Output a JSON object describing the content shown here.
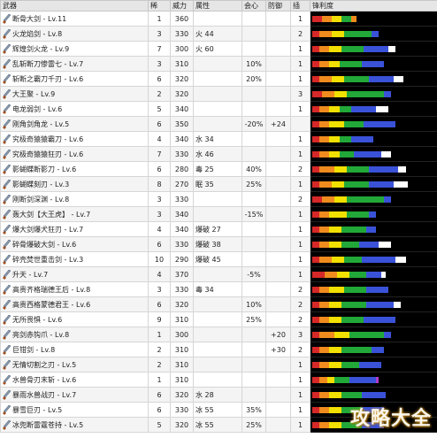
{
  "headers": [
    "武器",
    "稀",
    "威力",
    "属性",
    "会心",
    "防御",
    "插",
    "锋利度"
  ],
  "colors": {
    "red": "#d62828",
    "orange": "#f08c1e",
    "yellow": "#f2e000",
    "green": "#22a838",
    "blue": "#3a52d8",
    "white": "#ffffff",
    "purple": "#b03cc8",
    "empty": "#000000"
  },
  "rows": [
    {
      "name": "断骨大剑 - Lv.11",
      "rare": "1",
      "atk": "360",
      "elem": "",
      "crit": "",
      "def": "",
      "slots": "1",
      "sharp": [
        [
          "red",
          8
        ],
        [
          "orange",
          8
        ],
        [
          "yellow",
          8
        ],
        [
          "green",
          8
        ],
        [
          "orange",
          4
        ],
        [
          "empty",
          64
        ]
      ]
    },
    {
      "name": "火龙焰剑 - Lv.8",
      "rare": "3",
      "atk": "330",
      "elem": "火 44",
      "crit": "",
      "def": "",
      "slots": "2",
      "sharp": [
        [
          "red",
          6
        ],
        [
          "orange",
          10
        ],
        [
          "yellow",
          10
        ],
        [
          "green",
          22
        ],
        [
          "blue",
          6
        ],
        [
          "empty",
          46
        ]
      ]
    },
    {
      "name": "辉煌剑火龙 - Lv.9",
      "rare": "7",
      "atk": "300",
      "elem": "火 60",
      "crit": "",
      "def": "",
      "slots": "1",
      "sharp": [
        [
          "red",
          6
        ],
        [
          "orange",
          8
        ],
        [
          "yellow",
          10
        ],
        [
          "green",
          18
        ],
        [
          "blue",
          20
        ],
        [
          "white",
          6
        ],
        [
          "empty",
          32
        ]
      ]
    },
    {
      "name": "乱斩断刀惨雷七 - Lv.7",
      "rare": "3",
      "atk": "310",
      "elem": "",
      "crit": "10%",
      "def": "",
      "slots": "1",
      "sharp": [
        [
          "red",
          6
        ],
        [
          "orange",
          8
        ],
        [
          "yellow",
          8
        ],
        [
          "green",
          18
        ],
        [
          "blue",
          18
        ],
        [
          "empty",
          42
        ]
      ]
    },
    {
      "name": "斩断之霸刀千刃 - Lv.6",
      "rare": "6",
      "atk": "320",
      "elem": "",
      "crit": "20%",
      "def": "",
      "slots": "1",
      "sharp": [
        [
          "red",
          6
        ],
        [
          "orange",
          10
        ],
        [
          "yellow",
          10
        ],
        [
          "green",
          20
        ],
        [
          "blue",
          20
        ],
        [
          "white",
          8
        ],
        [
          "empty",
          26
        ]
      ]
    },
    {
      "name": "大王聚 - Lv.9",
      "rare": "2",
      "atk": "320",
      "elem": "",
      "crit": "",
      "def": "",
      "slots": "3",
      "sharp": [
        [
          "red",
          8
        ],
        [
          "orange",
          10
        ],
        [
          "yellow",
          10
        ],
        [
          "green",
          30
        ],
        [
          "blue",
          6
        ],
        [
          "empty",
          36
        ]
      ]
    },
    {
      "name": "电龙弱剑 - Lv.6",
      "rare": "5",
      "atk": "340",
      "elem": "",
      "crit": "",
      "def": "",
      "slots": "1",
      "sharp": [
        [
          "red",
          6
        ],
        [
          "orange",
          8
        ],
        [
          "yellow",
          8
        ],
        [
          "green",
          10
        ],
        [
          "blue",
          20
        ],
        [
          "white",
          10
        ],
        [
          "empty",
          38
        ]
      ]
    },
    {
      "name": "刚角剑角龙 - Lv.5",
      "rare": "6",
      "atk": "350",
      "elem": "",
      "crit": "-20%",
      "def": "+24",
      "slots": "",
      "sharp": [
        [
          "red",
          6
        ],
        [
          "orange",
          8
        ],
        [
          "yellow",
          12
        ],
        [
          "green",
          16
        ],
        [
          "blue",
          26
        ],
        [
          "empty",
          32
        ]
      ]
    },
    {
      "name": "究极奇猿猿霸刀 - Lv.6",
      "rare": "4",
      "atk": "340",
      "elem": "水 34",
      "crit": "",
      "def": "",
      "slots": "1",
      "sharp": [
        [
          "red",
          6
        ],
        [
          "orange",
          8
        ],
        [
          "yellow",
          8
        ],
        [
          "green",
          10
        ],
        [
          "blue",
          18
        ],
        [
          "empty",
          50
        ]
      ]
    },
    {
      "name": "究极奇猿猿狂刃 - Lv.6",
      "rare": "7",
      "atk": "330",
      "elem": "水 46",
      "crit": "",
      "def": "",
      "slots": "1",
      "sharp": [
        [
          "red",
          6
        ],
        [
          "orange",
          8
        ],
        [
          "yellow",
          8
        ],
        [
          "green",
          12
        ],
        [
          "blue",
          22
        ],
        [
          "white",
          8
        ],
        [
          "empty",
          36
        ]
      ]
    },
    {
      "name": "影蝴蝶断影刀 - Lv.6",
      "rare": "6",
      "atk": "280",
      "elem": "毒 25",
      "crit": "40%",
      "def": "",
      "slots": "2",
      "sharp": [
        [
          "red",
          6
        ],
        [
          "orange",
          12
        ],
        [
          "yellow",
          10
        ],
        [
          "green",
          18
        ],
        [
          "blue",
          24
        ],
        [
          "white",
          6
        ],
        [
          "empty",
          24
        ]
      ]
    },
    {
      "name": "影蝴蝶刻刃 - Lv.3",
      "rare": "8",
      "atk": "270",
      "elem": "眠 35",
      "crit": "25%",
      "def": "",
      "slots": "1",
      "sharp": [
        [
          "red",
          6
        ],
        [
          "orange",
          10
        ],
        [
          "yellow",
          10
        ],
        [
          "green",
          20
        ],
        [
          "blue",
          20
        ],
        [
          "white",
          12
        ],
        [
          "empty",
          22
        ]
      ]
    },
    {
      "name": "刚断剑深渊 - Lv.8",
      "rare": "3",
      "atk": "330",
      "elem": "",
      "crit": "",
      "def": "",
      "slots": "2",
      "sharp": [
        [
          "red",
          8
        ],
        [
          "orange",
          10
        ],
        [
          "yellow",
          10
        ],
        [
          "green",
          30
        ],
        [
          "blue",
          6
        ],
        [
          "empty",
          36
        ]
      ]
    },
    {
      "name": "轰大剑【大王虎】 - Lv.7",
      "rare": "3",
      "atk": "340",
      "elem": "",
      "crit": "-15%",
      "def": "",
      "slots": "1",
      "sharp": [
        [
          "red",
          6
        ],
        [
          "orange",
          8
        ],
        [
          "yellow",
          14
        ],
        [
          "green",
          18
        ],
        [
          "blue",
          6
        ],
        [
          "empty",
          48
        ]
      ]
    },
    {
      "name": "爆大剑爆犬狂刃 - Lv.7",
      "rare": "4",
      "atk": "340",
      "elem": "爆破 27",
      "crit": "",
      "def": "",
      "slots": "1",
      "sharp": [
        [
          "red",
          6
        ],
        [
          "orange",
          8
        ],
        [
          "yellow",
          10
        ],
        [
          "green",
          20
        ],
        [
          "blue",
          8
        ],
        [
          "empty",
          48
        ]
      ]
    },
    {
      "name": "碎骨爆破大剑 - Lv.6",
      "rare": "6",
      "atk": "330",
      "elem": "爆破 38",
      "crit": "",
      "def": "",
      "slots": "1",
      "sharp": [
        [
          "red",
          6
        ],
        [
          "orange",
          8
        ],
        [
          "yellow",
          10
        ],
        [
          "green",
          14
        ],
        [
          "blue",
          16
        ],
        [
          "white",
          10
        ],
        [
          "empty",
          36
        ]
      ]
    },
    {
      "name": "碎壳焚世重击剑 - Lv.3",
      "rare": "10",
      "atk": "290",
      "elem": "爆破 45",
      "crit": "",
      "def": "",
      "slots": "1",
      "sharp": [
        [
          "red",
          6
        ],
        [
          "orange",
          10
        ],
        [
          "yellow",
          10
        ],
        [
          "green",
          14
        ],
        [
          "blue",
          28
        ],
        [
          "white",
          8
        ],
        [
          "empty",
          24
        ]
      ]
    },
    {
      "name": "升天 - Lv.7",
      "rare": "4",
      "atk": "370",
      "elem": "",
      "crit": "-5%",
      "def": "",
      "slots": "1",
      "sharp": [
        [
          "red",
          10
        ],
        [
          "orange",
          10
        ],
        [
          "yellow",
          10
        ],
        [
          "green",
          14
        ],
        [
          "blue",
          12
        ],
        [
          "white",
          4
        ],
        [
          "empty",
          40
        ]
      ]
    },
    {
      "name": "高贵齐格瑞德王后 - Lv.8",
      "rare": "3",
      "atk": "330",
      "elem": "毒 34",
      "crit": "",
      "def": "",
      "slots": "2",
      "sharp": [
        [
          "red",
          6
        ],
        [
          "orange",
          8
        ],
        [
          "yellow",
          12
        ],
        [
          "green",
          18
        ],
        [
          "blue",
          18
        ],
        [
          "empty",
          38
        ]
      ]
    },
    {
      "name": "高贵西格蒙德君王 - Lv.6",
      "rare": "6",
      "atk": "320",
      "elem": "",
      "crit": "10%",
      "def": "",
      "slots": "2",
      "sharp": [
        [
          "red",
          6
        ],
        [
          "orange",
          8
        ],
        [
          "yellow",
          10
        ],
        [
          "green",
          20
        ],
        [
          "blue",
          22
        ],
        [
          "white",
          6
        ],
        [
          "empty",
          28
        ]
      ]
    },
    {
      "name": "无所畏惧 - Lv.6",
      "rare": "9",
      "atk": "310",
      "elem": "",
      "crit": "25%",
      "def": "",
      "slots": "2",
      "sharp": [
        [
          "red",
          6
        ],
        [
          "orange",
          8
        ],
        [
          "yellow",
          10
        ],
        [
          "green",
          18
        ],
        [
          "blue",
          26
        ],
        [
          "empty",
          32
        ]
      ]
    },
    {
      "name": "亮剑赤钩爪 - Lv.8",
      "rare": "1",
      "atk": "300",
      "elem": "",
      "crit": "",
      "def": "+20",
      "slots": "3",
      "sharp": [
        [
          "red",
          6
        ],
        [
          "orange",
          12
        ],
        [
          "yellow",
          12
        ],
        [
          "green",
          28
        ],
        [
          "blue",
          6
        ],
        [
          "empty",
          36
        ]
      ]
    },
    {
      "name": "巨钳剑 - Lv.8",
      "rare": "2",
      "atk": "310",
      "elem": "",
      "crit": "",
      "def": "+30",
      "slots": "2",
      "sharp": [
        [
          "red",
          6
        ],
        [
          "orange",
          8
        ],
        [
          "yellow",
          10
        ],
        [
          "green",
          24
        ],
        [
          "blue",
          10
        ],
        [
          "empty",
          42
        ]
      ]
    },
    {
      "name": "无情切割之刃 - Lv.5",
      "rare": "2",
      "atk": "310",
      "elem": "",
      "crit": "",
      "def": "",
      "slots": "1",
      "sharp": [
        [
          "red",
          6
        ],
        [
          "orange",
          8
        ],
        [
          "yellow",
          10
        ],
        [
          "green",
          14
        ],
        [
          "blue",
          18
        ],
        [
          "empty",
          44
        ]
      ]
    },
    {
      "name": "水兽骨刃末斩 - Lv.6",
      "rare": "1",
      "atk": "310",
      "elem": "",
      "crit": "",
      "def": "",
      "slots": "1",
      "sharp": [
        [
          "red",
          6
        ],
        [
          "orange",
          6
        ],
        [
          "yellow",
          6
        ],
        [
          "green",
          12
        ],
        [
          "blue",
          22
        ],
        [
          "purple",
          2
        ],
        [
          "empty",
          46
        ]
      ]
    },
    {
      "name": "暴雨水兽战刃 - Lv.7",
      "rare": "6",
      "atk": "320",
      "elem": "水 28",
      "crit": "",
      "def": "",
      "slots": "1",
      "sharp": [
        [
          "red",
          6
        ],
        [
          "orange",
          8
        ],
        [
          "yellow",
          10
        ],
        [
          "green",
          16
        ],
        [
          "blue",
          20
        ],
        [
          "empty",
          40
        ]
      ]
    },
    {
      "name": "暴雪巨刃 - Lv.5",
      "rare": "6",
      "atk": "330",
      "elem": "冰 55",
      "crit": "35%",
      "def": "",
      "slots": "1",
      "sharp": [
        [
          "red",
          6
        ],
        [
          "orange",
          8
        ],
        [
          "yellow",
          10
        ],
        [
          "green",
          16
        ],
        [
          "blue",
          18
        ],
        [
          "empty",
          42
        ]
      ]
    },
    {
      "name": "冰兜断雷霆苍持 - Lv.5",
      "rare": "5",
      "atk": "320",
      "elem": "冰 55",
      "crit": "25%",
      "def": "",
      "slots": "1",
      "sharp": [
        [
          "red",
          6
        ],
        [
          "orange",
          8
        ],
        [
          "yellow",
          10
        ],
        [
          "green",
          16
        ],
        [
          "blue",
          18
        ],
        [
          "empty",
          42
        ]
      ]
    }
  ],
  "watermark": "攻略大全"
}
